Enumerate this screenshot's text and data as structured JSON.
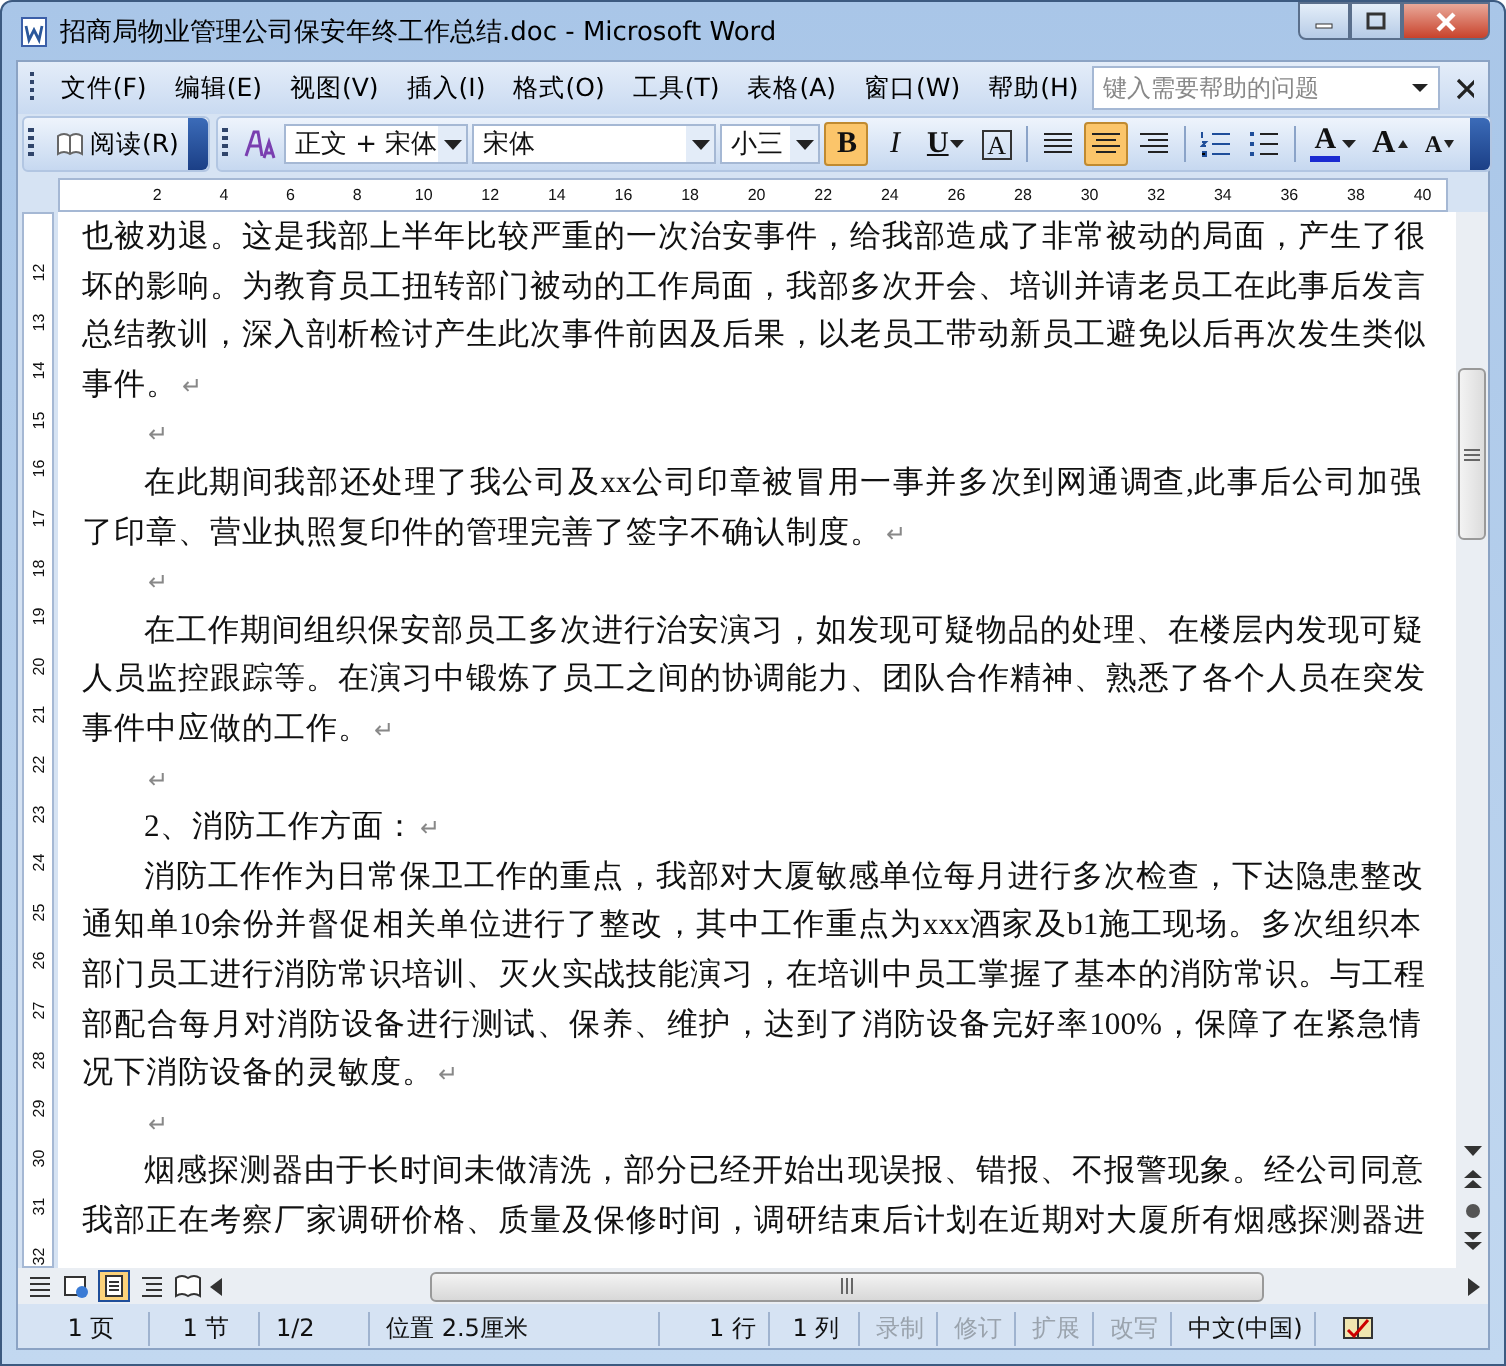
{
  "window": {
    "title": "招商局物业管理公司保安年终工作总结.doc - Microsoft Word"
  },
  "menu": [
    "文件(F)",
    "编辑(E)",
    "视图(V)",
    "插入(I)",
    "格式(O)",
    "工具(T)",
    "表格(A)",
    "窗口(W)",
    "帮助(H)"
  ],
  "help_search": {
    "placeholder": "键入需要帮助的问题"
  },
  "toolbar": {
    "read_button": "阅读(R)",
    "style": "正文 + 宋体",
    "font": "宋体",
    "size": "小三",
    "buttons": [
      {
        "kind": "bold",
        "label": "B",
        "selected": true
      },
      {
        "kind": "italic",
        "label": "I",
        "selected": false
      },
      {
        "kind": "underline",
        "label": "U",
        "selected": false
      },
      {
        "kind": "border",
        "label": "A",
        "selected": false
      },
      {
        "kind": "justify",
        "selected": false
      },
      {
        "kind": "center",
        "selected": true
      },
      {
        "kind": "right",
        "selected": false
      },
      {
        "kind": "numbering",
        "selected": false
      },
      {
        "kind": "bullets",
        "selected": false
      },
      {
        "kind": "font-color",
        "label": "A",
        "selected": false
      },
      {
        "kind": "grow",
        "label": "A",
        "selected": false
      },
      {
        "kind": "shrink",
        "label": "A",
        "selected": false
      }
    ]
  },
  "ruler": {
    "horizontal": [
      "2",
      "4",
      "6",
      "8",
      "10",
      "12",
      "14",
      "16",
      "18",
      "20",
      "22",
      "24",
      "26",
      "28",
      "30",
      "32",
      "34",
      "36",
      "38",
      "40"
    ],
    "vertical": [
      "12",
      "13",
      "14",
      "15",
      "16",
      "17",
      "18",
      "19",
      "20",
      "21",
      "22",
      "23",
      "24",
      "25",
      "26",
      "27",
      "28",
      "29",
      "30",
      "31",
      "32"
    ]
  },
  "document": {
    "paragraphs": [
      {
        "indent": false,
        "end_mark": "↵",
        "lines": [
          "也被劝退。这是我部上半年比较严重的一次治安事件，给我部造成了非常被动的局面，产生了很",
          "坏的影响。为教育员工扭转部门被动的工作局面，我部多次开会、培训并请老员工在此事后发言",
          "总结教训，深入剖析检讨产生此次事件前因及后果，以老员工带动新员工避免以后再次发生类似",
          "事件。"
        ]
      },
      {
        "indent": true,
        "end_mark": "↵"
      },
      {
        "indent": true,
        "end_mark": "↵",
        "lines": [
          "在此期间我部还处理了我公司及xx公司印章被冒用一事并多次到网通调查,此事后公司加强",
          "了印章、营业执照复印件的管理完善了签字不确认制度。"
        ]
      },
      {
        "indent": true,
        "end_mark": "↵"
      },
      {
        "indent": true,
        "end_mark": "↵",
        "lines": [
          "在工作期间组织保安部员工多次进行治安演习，如发现可疑物品的处理、在楼层内发现可疑",
          "人员监控跟踪等。在演习中锻炼了员工之间的协调能力、团队合作精神、熟悉了各个人员在突发",
          "事件中应做的工作。"
        ]
      },
      {
        "indent": true,
        "end_mark": "↵"
      },
      {
        "indent": true,
        "end_mark": "↵",
        "lines": [
          "2、消防工作方面："
        ]
      },
      {
        "indent": true,
        "end_mark": "↵",
        "lines": [
          "消防工作作为日常保卫工作的重点，我部对大厦敏感单位每月进行多次检查，下达隐患整改",
          "通知单10余份并督促相关单位进行了整改，其中工作重点为xxx酒家及b1施工现场。多次组织本",
          "部门员工进行消防常识培训、灭火实战技能演习，在培训中员工掌握了基本的消防常识。与工程",
          "部配合每月对消防设备进行测试、保养、维护，达到了消防设备完好率100%，保障了在紧急情",
          "况下消防设备的灵敏度。"
        ]
      },
      {
        "indent": true,
        "end_mark": "↵"
      },
      {
        "indent": true,
        "lines": [
          "烟感探测器由于长时间未做清洗，部分已经开始出现误报、错报、不报警现象。经公司同意",
          "我部正在考察厂家调研价格、质量及保修时间，调研结束后计划在近期对大厦所有烟感探测器进"
        ]
      }
    ]
  },
  "status_bar": [
    {
      "text": "1 页",
      "disabled": false
    },
    {
      "text": "1 节",
      "disabled": false
    },
    {
      "text": "1/2",
      "disabled": false
    },
    {
      "text": "位置 2.5厘米",
      "disabled": false
    },
    {
      "text": "1 行",
      "disabled": false
    },
    {
      "text": "1 列",
      "disabled": false
    },
    {
      "text": "录制",
      "disabled": true
    },
    {
      "text": "修订",
      "disabled": true
    },
    {
      "text": "扩展",
      "disabled": true
    },
    {
      "text": "改写",
      "disabled": true
    },
    {
      "text": "中文(中国)",
      "disabled": false
    }
  ]
}
